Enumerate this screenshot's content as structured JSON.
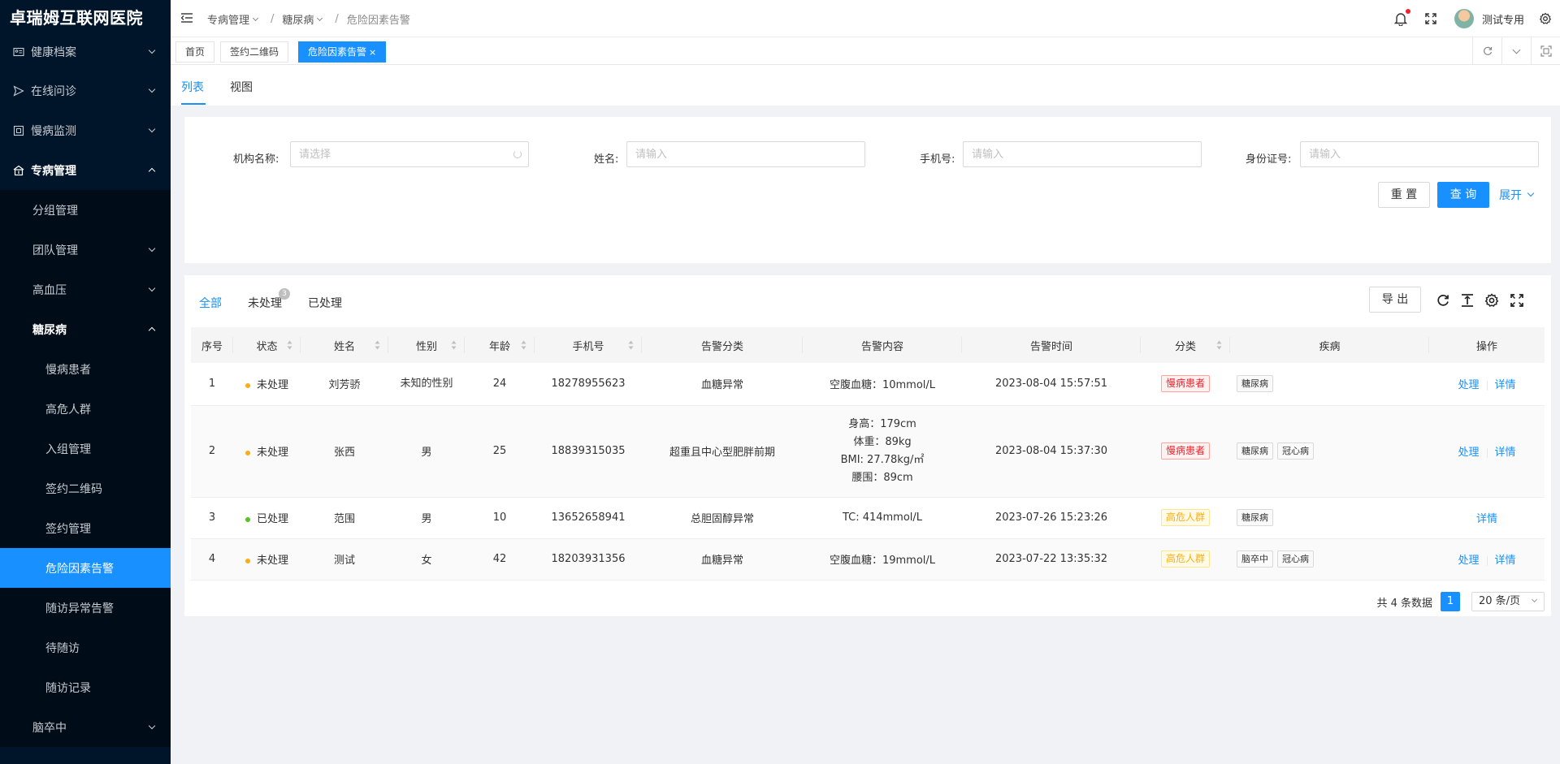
{
  "sidebar": {
    "logo": "卓瑞姆互联网医院",
    "items": [
      {
        "label": "健康档案"
      },
      {
        "label": "在线问诊"
      },
      {
        "label": "慢病监测"
      },
      {
        "label": "专病管理"
      },
      {
        "label": "分组管理"
      },
      {
        "label": "团队管理"
      },
      {
        "label": "高血压"
      },
      {
        "label": "糖尿病"
      },
      {
        "label": "慢病患者"
      },
      {
        "label": "高危人群"
      },
      {
        "label": "入组管理"
      },
      {
        "label": "签约二维码"
      },
      {
        "label": "签约管理"
      },
      {
        "label": "危险因素告警"
      },
      {
        "label": "随访异常告警"
      },
      {
        "label": "待随访"
      },
      {
        "label": "随访记录"
      },
      {
        "label": "脑卒中"
      }
    ]
  },
  "header": {
    "breadcrumb": [
      "专病管理",
      "糖尿病",
      "危险因素告警"
    ],
    "user_name": "测试专用"
  },
  "tags": [
    {
      "label": "首页"
    },
    {
      "label": "签约二维码"
    },
    {
      "label": "危险因素告警",
      "close": "×"
    }
  ],
  "view_tabs": [
    "列表",
    "视图"
  ],
  "search": {
    "org_label": "机构名称:",
    "org_placeholder": "请选择",
    "name_label": "姓名:",
    "name_placeholder": "请输入",
    "phone_label": "手机号:",
    "phone_placeholder": "请输入",
    "id_label": "身份证号:",
    "id_placeholder": "请输入",
    "reset": "重 置",
    "query": "查 询",
    "expand": "展开"
  },
  "status_tabs": [
    {
      "label": "全部"
    },
    {
      "label": "未处理",
      "badge": "3"
    },
    {
      "label": "已处理"
    }
  ],
  "toolbar": {
    "export": "导 出"
  },
  "table": {
    "columns": [
      "序号",
      "状态",
      "姓名",
      "性别",
      "年龄",
      "手机号",
      "告警分类",
      "告警内容",
      "告警时间",
      "分类",
      "疾病",
      "操作"
    ],
    "rows": [
      {
        "no": "1",
        "status": "未处理",
        "name": "刘芳骄",
        "gender": "未知的性别",
        "age": "24",
        "phone": "18278955623",
        "alert_type": "血糖异常",
        "content": [
          "空腹血糖：10mmol/L"
        ],
        "time": "2023-08-04 15:57:51",
        "category": "慢病患者",
        "diseases": [
          "糖尿病"
        ],
        "ops": [
          "处理",
          "详情"
        ]
      },
      {
        "no": "2",
        "status": "未处理",
        "name": "张西",
        "gender": "男",
        "age": "25",
        "phone": "18839315035",
        "alert_type": "超重且中心型肥胖前期",
        "content": [
          "身高：179cm",
          "体重：89kg",
          "BMI: 27.78kg/㎡",
          "腰围：89cm"
        ],
        "time": "2023-08-04 15:37:30",
        "category": "慢病患者",
        "diseases": [
          "糖尿病",
          "冠心病"
        ],
        "ops": [
          "处理",
          "详情"
        ]
      },
      {
        "no": "3",
        "status": "已处理",
        "name": "范围",
        "gender": "男",
        "age": "10",
        "phone": "13652658941",
        "alert_type": "总胆固醇异常",
        "content": [
          "TC: 414mmol/L"
        ],
        "time": "2023-07-26 15:23:26",
        "category": "高危人群",
        "diseases": [
          "糖尿病"
        ],
        "ops": [
          "详情"
        ]
      },
      {
        "no": "4",
        "status": "未处理",
        "name": "测试",
        "gender": "女",
        "age": "42",
        "phone": "18203931356",
        "alert_type": "血糖异常",
        "content": [
          "空腹血糖：19mmol/L"
        ],
        "time": "2023-07-22 13:35:32",
        "category": "高危人群",
        "diseases": [
          "脑卒中",
          "冠心病"
        ],
        "ops": [
          "处理",
          "详情"
        ]
      }
    ]
  },
  "pagination": {
    "total_text": "共 4 条数据",
    "current_page": "1",
    "page_size": "20 条/页"
  },
  "colors": {
    "sidebar_bg": "#001529",
    "primary": "#1890ff",
    "status_pending": "#faad14",
    "status_done": "#52c41a"
  }
}
